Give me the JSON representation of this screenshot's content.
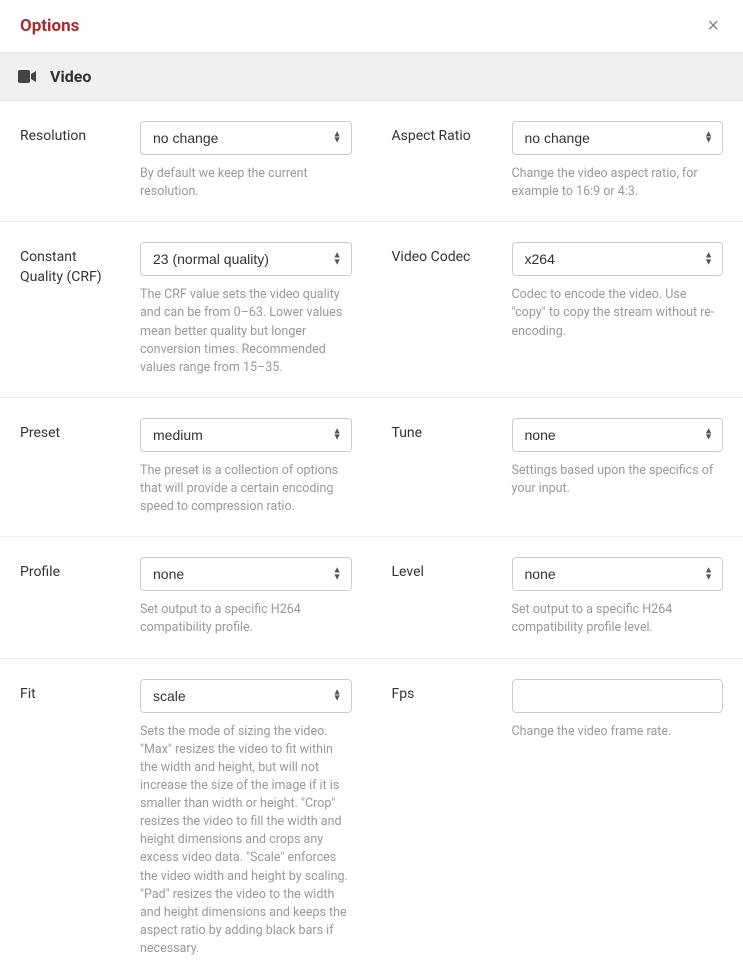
{
  "header": {
    "title": "Options",
    "close": "×"
  },
  "section": {
    "title": "Video"
  },
  "fields": {
    "resolution": {
      "label": "Resolution",
      "value": "no change",
      "help": "By default we keep the current resolution."
    },
    "aspect_ratio": {
      "label": "Aspect Ratio",
      "value": "no change",
      "help": "Change the video aspect ratio, for example to 16:9 or 4:3."
    },
    "crf": {
      "label": "Constant Quality (CRF)",
      "value": "23 (normal quality)",
      "help": "The CRF value sets the video quality and can be from 0–63. Lower values mean better quality but longer conversion times. Recommended values range from 15–35."
    },
    "video_codec": {
      "label": "Video Codec",
      "value": "x264",
      "help": "Codec to encode the video. Use \"copy\" to copy the stream without re-encoding."
    },
    "preset": {
      "label": "Preset",
      "value": "medium",
      "help": "The preset is a collection of options that will provide a certain encoding speed to compression ratio."
    },
    "tune": {
      "label": "Tune",
      "value": "none",
      "help": "Settings based upon the specifics of your input."
    },
    "profile": {
      "label": "Profile",
      "value": "none",
      "help": "Set output to a specific H264 compatibility profile."
    },
    "level": {
      "label": "Level",
      "value": "none",
      "help": "Set output to a specific H264 compatibility profile level."
    },
    "fit": {
      "label": "Fit",
      "value": "scale",
      "help": "Sets the mode of sizing the video. \"Max\" resizes the video to fit within the width and height, but will not increase the size of the image if it is smaller than width or height. \"Crop\" resizes the video to fill the width and height dimensions and crops any excess video data. \"Scale\" enforces the video width and height by scaling. \"Pad\" resizes the video to the width and height dimensions and keeps the aspect ratio by adding black bars if necessary."
    },
    "fps": {
      "label": "Fps",
      "value": "",
      "help": "Change the video frame rate."
    }
  }
}
